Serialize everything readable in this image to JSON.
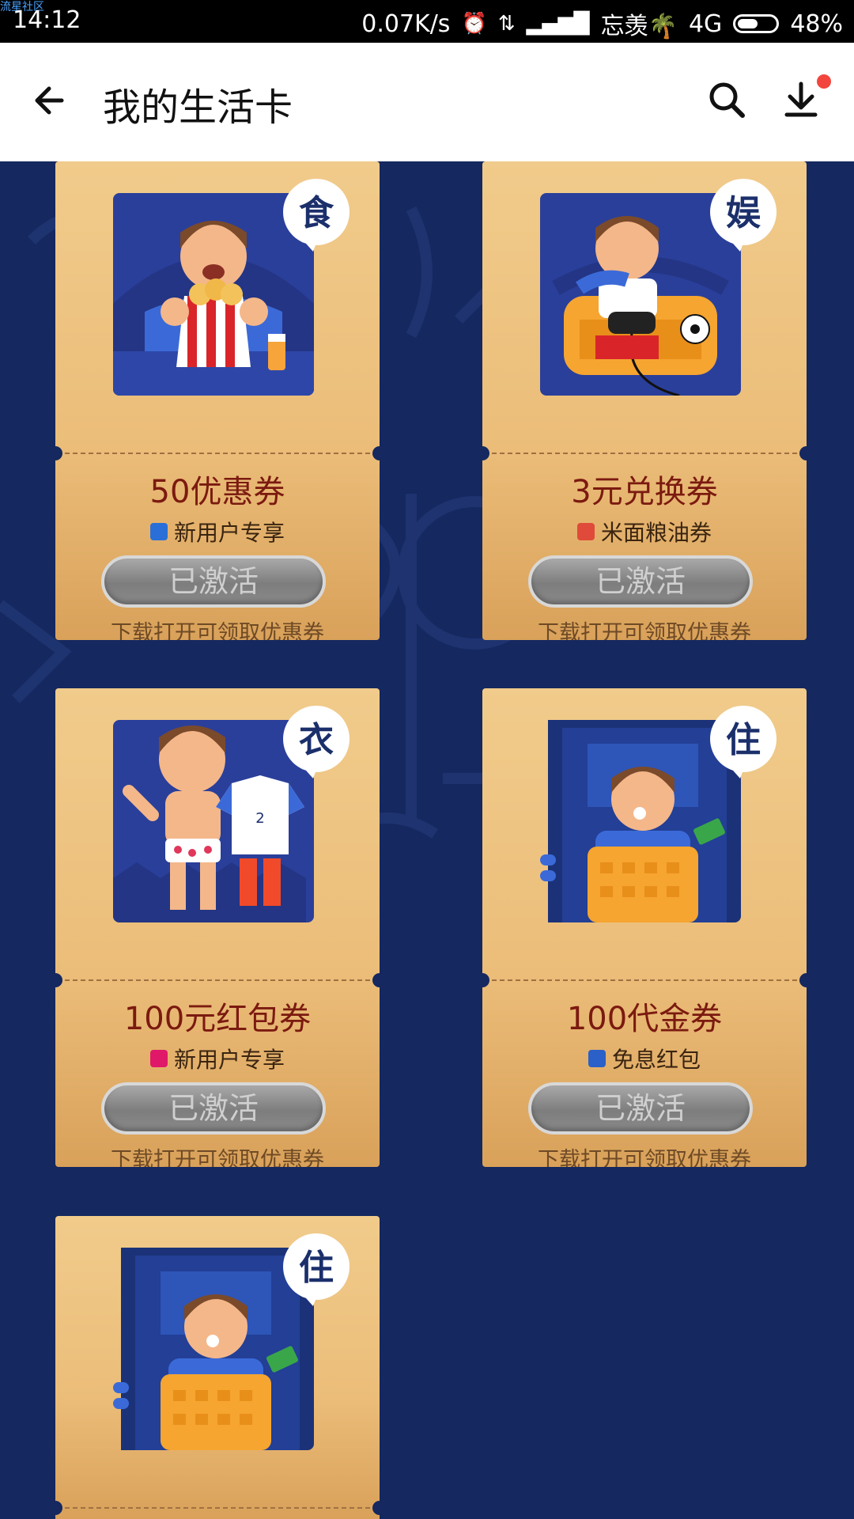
{
  "status_bar": {
    "watermark": "流星社区",
    "time": "14:12",
    "net_speed": "0.07K/s",
    "carrier": "忘羡🌴",
    "network": "4G",
    "battery": "48%",
    "battery_level": 0.48
  },
  "header": {
    "title": "我的生活卡",
    "has_notification_dot": true
  },
  "cards": [
    {
      "badge": "食",
      "title": "50优惠券",
      "subtitle": "新用户专享",
      "button": "已激活",
      "hint": "下载打开可领取优惠券",
      "app_icon_color": "#2a6fd8"
    },
    {
      "badge": "娱",
      "title": "3元兑换券",
      "subtitle": "米面粮油券",
      "button": "已激活",
      "hint": "下载打开可领取优惠券",
      "app_icon_color": "#e04a3a"
    },
    {
      "badge": "衣",
      "title": "100元红包券",
      "subtitle": "新用户专享",
      "button": "已激活",
      "hint": "下载打开可领取优惠券",
      "app_icon_color": "#e0186a"
    },
    {
      "badge": "住",
      "title": "100代金券",
      "subtitle": "免息红包",
      "button": "已激活",
      "hint": "下载打开可领取优惠券",
      "app_icon_color": "#2a60c8"
    },
    {
      "badge": "住"
    }
  ],
  "colors": {
    "background": "#15285f",
    "card_top": "#f1cb8b",
    "card_bottom": "#d9a15a",
    "title_text": "#7b1a10",
    "badge_text": "#1b2f6b"
  }
}
